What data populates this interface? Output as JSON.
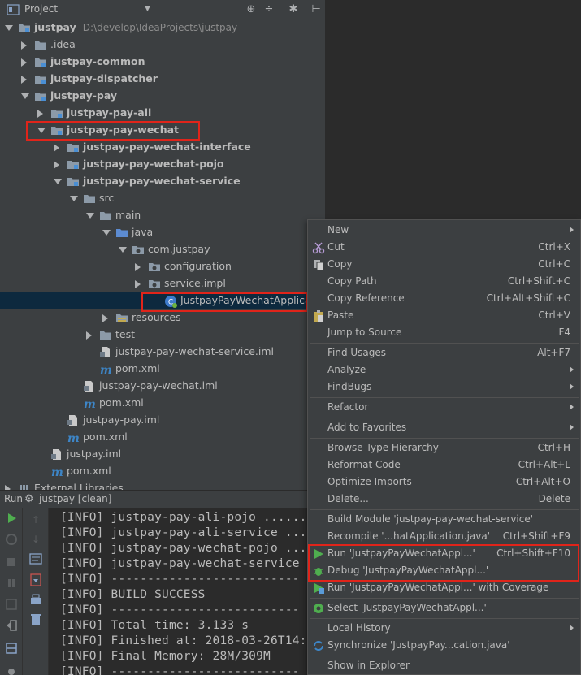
{
  "project": {
    "title": "Project",
    "tree": [
      {
        "label": "justpay",
        "path": "D:\\develop\\IdeaProjects\\justpay",
        "depth": 0,
        "arrow": "down",
        "icon": "module-folder-icon",
        "bold": true
      },
      {
        "label": ".idea",
        "depth": 1,
        "arrow": "right",
        "icon": "folder-icon",
        "bold": false
      },
      {
        "label": "justpay-common",
        "depth": 1,
        "arrow": "right",
        "icon": "module-folder-icon",
        "bold": true
      },
      {
        "label": "justpay-dispatcher",
        "depth": 1,
        "arrow": "right",
        "icon": "module-folder-icon",
        "bold": true
      },
      {
        "label": "justpay-pay",
        "depth": 1,
        "arrow": "down",
        "icon": "module-folder-icon",
        "bold": true
      },
      {
        "label": "justpay-pay-ali",
        "depth": 2,
        "arrow": "right",
        "icon": "module-folder-icon",
        "bold": true
      },
      {
        "label": "justpay-pay-wechat",
        "depth": 2,
        "arrow": "down",
        "icon": "module-folder-icon",
        "bold": true
      },
      {
        "label": "justpay-pay-wechat-interface",
        "depth": 3,
        "arrow": "right",
        "icon": "module-folder-icon",
        "bold": true
      },
      {
        "label": "justpay-pay-wechat-pojo",
        "depth": 3,
        "arrow": "right",
        "icon": "module-folder-icon",
        "bold": true
      },
      {
        "label": "justpay-pay-wechat-service",
        "depth": 3,
        "arrow": "down",
        "icon": "module-folder-icon",
        "bold": true
      },
      {
        "label": "src",
        "depth": 4,
        "arrow": "down",
        "icon": "folder-icon",
        "bold": false
      },
      {
        "label": "main",
        "depth": 5,
        "arrow": "down",
        "icon": "folder-icon",
        "bold": false
      },
      {
        "label": "java",
        "depth": 6,
        "arrow": "down",
        "icon": "source-folder-icon",
        "bold": false
      },
      {
        "label": "com.justpay",
        "depth": 7,
        "arrow": "down",
        "icon": "package-icon",
        "bold": false
      },
      {
        "label": "configuration",
        "depth": 8,
        "arrow": "right",
        "icon": "package-icon",
        "bold": false
      },
      {
        "label": "service.impl",
        "depth": 8,
        "arrow": "right",
        "icon": "package-icon",
        "bold": false
      },
      {
        "label": "JustpayPayWechatApplication",
        "depth": 9,
        "arrow": "none",
        "icon": "spring-class-icon",
        "bold": false,
        "selected": true
      },
      {
        "label": "resources",
        "depth": 6,
        "arrow": "right",
        "icon": "resources-folder-icon",
        "bold": false
      },
      {
        "label": "test",
        "depth": 5,
        "arrow": "right",
        "icon": "folder-icon",
        "bold": false
      },
      {
        "label": "justpay-pay-wechat-service.iml",
        "depth": 5,
        "arrow": "none",
        "icon": "iml-file-icon",
        "bold": false
      },
      {
        "label": "pom.xml",
        "depth": 5,
        "arrow": "none",
        "icon": "maven-icon",
        "bold": false
      },
      {
        "label": "justpay-pay-wechat.iml",
        "depth": 4,
        "arrow": "none",
        "icon": "iml-file-icon",
        "bold": false
      },
      {
        "label": "pom.xml",
        "depth": 4,
        "arrow": "none",
        "icon": "maven-icon",
        "bold": false
      },
      {
        "label": "justpay-pay.iml",
        "depth": 3,
        "arrow": "none",
        "icon": "iml-file-icon",
        "bold": false
      },
      {
        "label": "pom.xml",
        "depth": 3,
        "arrow": "none",
        "icon": "maven-icon",
        "bold": false
      },
      {
        "label": "justpay.iml",
        "depth": 2,
        "arrow": "none",
        "icon": "iml-file-icon",
        "bold": false
      },
      {
        "label": "pom.xml",
        "depth": 2,
        "arrow": "none",
        "icon": "maven-icon",
        "bold": false
      },
      {
        "label": "External Libraries",
        "depth": 0,
        "arrow": "right",
        "icon": "library-icon",
        "bold": false
      }
    ]
  },
  "run": {
    "title": "Run",
    "config": "justpay [clean]",
    "console": [
      "[INFO] justpay-pay-ali-pojo .......",
      "[INFO] justpay-pay-ali-service ...",
      "[INFO] justpay-pay-wechat-pojo ...",
      "[INFO] justpay-pay-wechat-service",
      "[INFO] --------------------------",
      "[INFO] BUILD SUCCESS",
      "[INFO] --------------------------",
      "[INFO] Total time: 3.133 s",
      "[INFO] Finished at: 2018-03-26T14:",
      "[INFO] Final Memory: 28M/309M",
      "[INFO] --------------------------"
    ]
  },
  "context_menu": {
    "items": [
      {
        "label": "New",
        "shortcut": "",
        "submenu": true,
        "icon": ""
      },
      {
        "label": "Cut",
        "shortcut": "Ctrl+X",
        "submenu": false,
        "icon": "cut-icon"
      },
      {
        "label": "Copy",
        "shortcut": "Ctrl+C",
        "submenu": false,
        "icon": "copy-icon"
      },
      {
        "label": "Copy Path",
        "shortcut": "Ctrl+Shift+C",
        "submenu": false,
        "icon": ""
      },
      {
        "label": "Copy Reference",
        "shortcut": "Ctrl+Alt+Shift+C",
        "submenu": false,
        "icon": ""
      },
      {
        "label": "Paste",
        "shortcut": "Ctrl+V",
        "submenu": false,
        "icon": "paste-icon"
      },
      {
        "label": "Jump to Source",
        "shortcut": "F4",
        "submenu": false,
        "icon": ""
      },
      {
        "sep": true
      },
      {
        "label": "Find Usages",
        "shortcut": "Alt+F7",
        "submenu": false,
        "icon": ""
      },
      {
        "label": "Analyze",
        "shortcut": "",
        "submenu": true,
        "icon": ""
      },
      {
        "label": "FindBugs",
        "shortcut": "",
        "submenu": true,
        "icon": ""
      },
      {
        "sep": true
      },
      {
        "label": "Refactor",
        "shortcut": "",
        "submenu": true,
        "icon": ""
      },
      {
        "sep": true
      },
      {
        "label": "Add to Favorites",
        "shortcut": "",
        "submenu": true,
        "icon": ""
      },
      {
        "sep": true
      },
      {
        "label": "Browse Type Hierarchy",
        "shortcut": "Ctrl+H",
        "submenu": false,
        "icon": ""
      },
      {
        "label": "Reformat Code",
        "shortcut": "Ctrl+Alt+L",
        "submenu": false,
        "icon": ""
      },
      {
        "label": "Optimize Imports",
        "shortcut": "Ctrl+Alt+O",
        "submenu": false,
        "icon": ""
      },
      {
        "label": "Delete...",
        "shortcut": "Delete",
        "submenu": false,
        "icon": ""
      },
      {
        "sep": true
      },
      {
        "label": "Build Module 'justpay-pay-wechat-service'",
        "shortcut": "",
        "submenu": false,
        "icon": ""
      },
      {
        "label": "Recompile '...hatApplication.java'",
        "shortcut": "Ctrl+Shift+F9",
        "submenu": false,
        "icon": ""
      },
      {
        "label": "Run 'JustpayPayWechatAppl...'",
        "shortcut": "Ctrl+Shift+F10",
        "submenu": false,
        "icon": "run-icon"
      },
      {
        "label": "Debug 'JustpayPayWechatAppl...'",
        "shortcut": "",
        "submenu": false,
        "icon": "debug-icon"
      },
      {
        "label": "Run 'JustpayPayWechatAppl...' with Coverage",
        "shortcut": "",
        "submenu": false,
        "icon": "coverage-icon"
      },
      {
        "sep": true
      },
      {
        "label": "Select 'JustpayPayWechatAppl...'",
        "shortcut": "",
        "submenu": false,
        "icon": "select-icon"
      },
      {
        "sep": true
      },
      {
        "label": "Local History",
        "shortcut": "",
        "submenu": true,
        "icon": ""
      },
      {
        "label": "Synchronize 'JustpayPay...cation.java'",
        "shortcut": "",
        "submenu": false,
        "icon": "sync-icon"
      },
      {
        "sep": true
      },
      {
        "label": "Show in Explorer",
        "shortcut": "",
        "submenu": false,
        "icon": ""
      }
    ]
  },
  "colors": {
    "highlight_box": "#e0241a",
    "selection": "#0d293e",
    "run_green": "#4fae4f"
  }
}
